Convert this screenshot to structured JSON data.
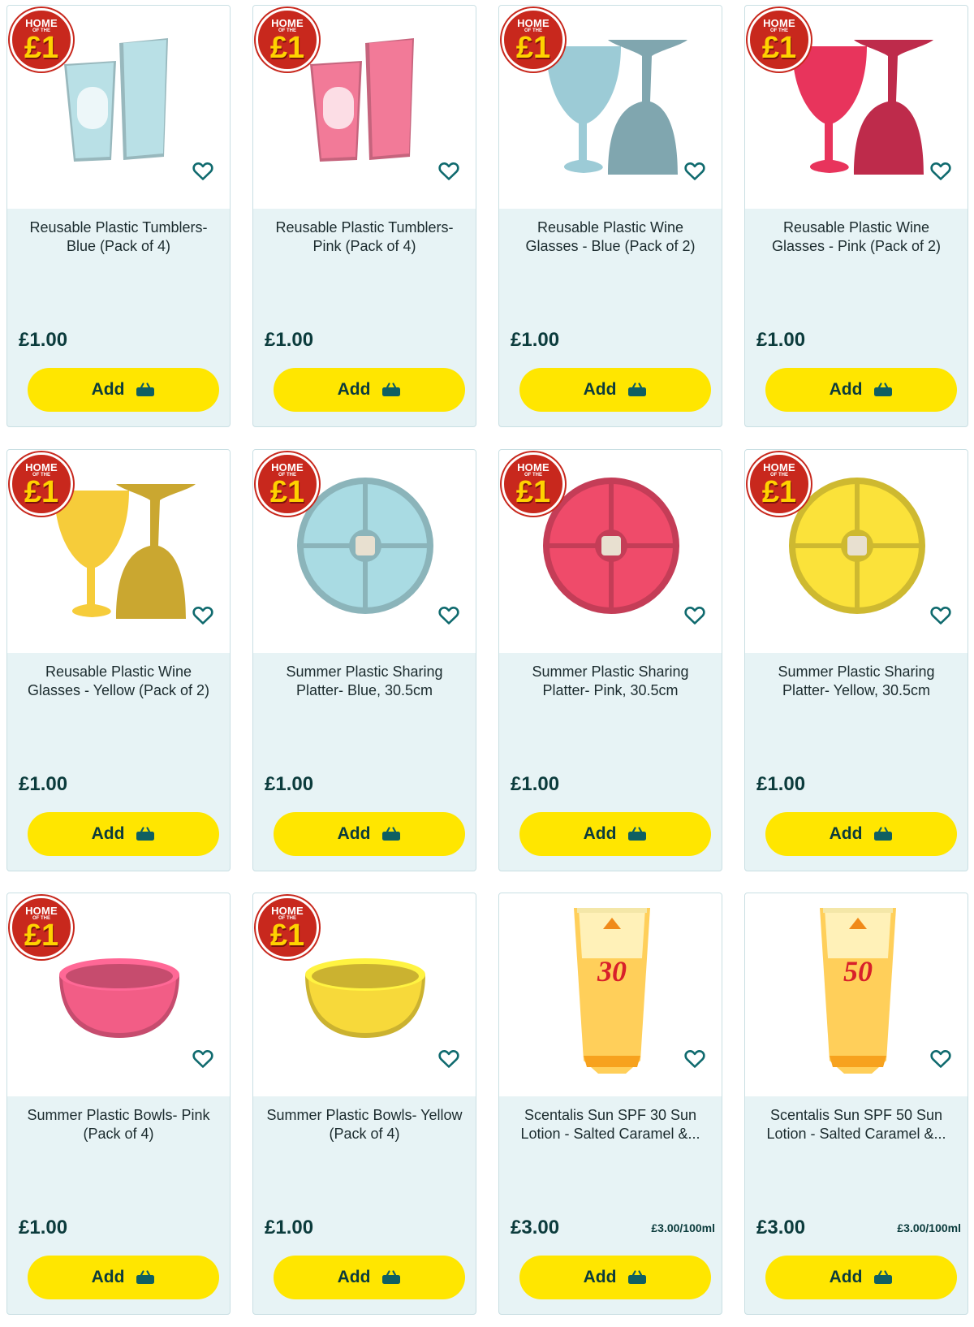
{
  "colors": {
    "card_bg": "#e7f3f5",
    "add_button": "#ffe600",
    "badge_red": "#c8281d",
    "badge_yellow": "#ffd200",
    "text_dark": "#0b3b3c"
  },
  "badge": {
    "line1": "HOME",
    "line2": "OF THE",
    "price": "£1"
  },
  "products": [
    {
      "name": "Reusable Plastic Tumblers- Blue (Pack of 4)",
      "price": "£1.00",
      "unit_price": "",
      "add_label": "Add",
      "badge": true,
      "image": "tumblers",
      "color": "#b9e0e6"
    },
    {
      "name": "Reusable Plastic Tumblers- Pink (Pack of 4)",
      "price": "£1.00",
      "unit_price": "",
      "add_label": "Add",
      "badge": true,
      "image": "tumblers",
      "color": "#f27a98"
    },
    {
      "name": "Reusable Plastic Wine Glasses - Blue (Pack of 2)",
      "price": "£1.00",
      "unit_price": "",
      "add_label": "Add",
      "badge": true,
      "image": "wine",
      "color": "#9ccbd6"
    },
    {
      "name": "Reusable Plastic Wine Glasses - Pink (Pack of 2)",
      "price": "£1.00",
      "unit_price": "",
      "add_label": "Add",
      "badge": true,
      "image": "wine",
      "color": "#e8345c"
    },
    {
      "name": "Reusable Plastic Wine Glasses - Yellow (Pack of 2)",
      "price": "£1.00",
      "unit_price": "",
      "add_label": "Add",
      "badge": true,
      "image": "wine",
      "color": "#f6cc3a"
    },
    {
      "name": "Summer Plastic Sharing Platter- Blue, 30.5cm",
      "price": "£1.00",
      "unit_price": "",
      "add_label": "Add",
      "badge": true,
      "image": "platter",
      "color": "#a9dbe3"
    },
    {
      "name": "Summer Plastic Sharing Platter- Pink, 30.5cm",
      "price": "£1.00",
      "unit_price": "",
      "add_label": "Add",
      "badge": true,
      "image": "platter",
      "color": "#ef4b6a"
    },
    {
      "name": "Summer Plastic Sharing Platter- Yellow, 30.5cm",
      "price": "£1.00",
      "unit_price": "",
      "add_label": "Add",
      "badge": true,
      "image": "platter",
      "color": "#fbe23a"
    },
    {
      "name": "Summer Plastic Bowls- Pink (Pack of 4)",
      "price": "£1.00",
      "unit_price": "",
      "add_label": "Add",
      "badge": true,
      "image": "bowl",
      "color": "#f25d86"
    },
    {
      "name": "Summer Plastic Bowls- Yellow (Pack of 4)",
      "price": "£1.00",
      "unit_price": "",
      "add_label": "Add",
      "badge": true,
      "image": "bowl",
      "color": "#f7d93a"
    },
    {
      "name": "Scentalis Sun SPF 30 Sun Lotion - Salted Caramel &...",
      "price": "£3.00",
      "unit_price": "£3.00/100ml",
      "add_label": "Add",
      "badge": false,
      "image": "lotion",
      "color": "#ffcf5a",
      "spf": "30"
    },
    {
      "name": "Scentalis Sun SPF 50 Sun Lotion - Salted Caramel &...",
      "price": "£3.00",
      "unit_price": "£3.00/100ml",
      "add_label": "Add",
      "badge": false,
      "image": "lotion",
      "color": "#ffcf5a",
      "spf": "50"
    }
  ]
}
